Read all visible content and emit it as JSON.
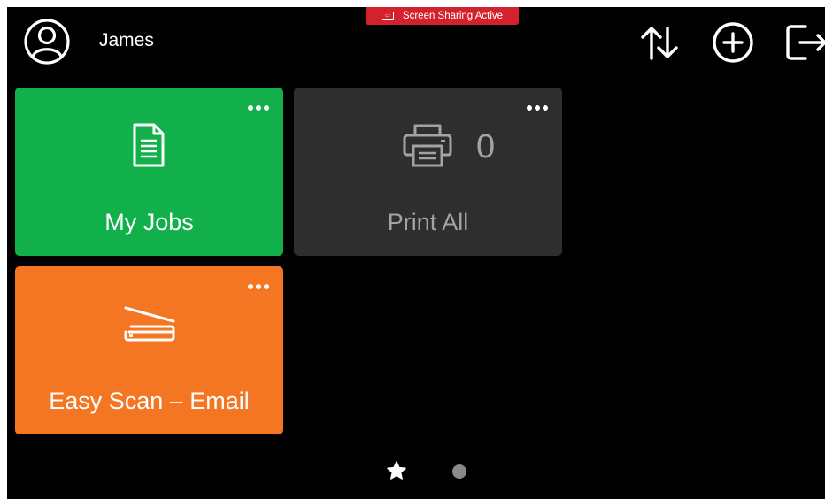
{
  "header": {
    "user_name": "James",
    "sharing_banner": "Screen Sharing Active",
    "banner_color": "#d3222d"
  },
  "tiles": [
    {
      "label": "My Jobs",
      "color": "#12b04b",
      "icon": "document-icon"
    },
    {
      "label": "Print All",
      "color": "#2e2e2e",
      "icon": "printer-icon",
      "count": "0"
    },
    {
      "label": "Easy Scan – Email",
      "color": "#f47622",
      "icon": "scanner-icon"
    }
  ],
  "header_icons": [
    "sort-icon",
    "add-icon",
    "logout-icon"
  ],
  "pager": {
    "pages": 2,
    "current": 1,
    "first_page_icon": "star-icon"
  }
}
